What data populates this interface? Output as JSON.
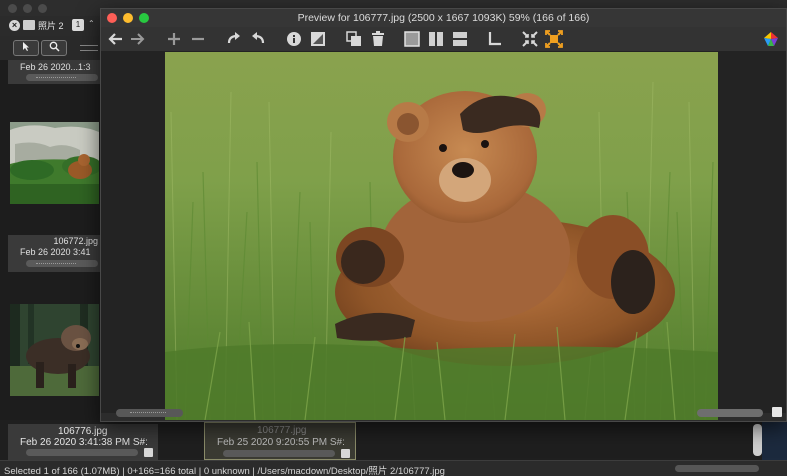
{
  "browser": {
    "tab": {
      "name": "照片 2",
      "count": "1",
      "close_symbol": "×",
      "caret": "⌃"
    },
    "toolbar": {
      "select_tool": "↖",
      "zoom_tool": "🔍"
    },
    "cells": [
      {
        "name": "",
        "date": "Feb 26 2020...1:3"
      },
      {
        "name": "106772.jpg",
        "date": "Feb 26 2020 3:41"
      },
      {
        "name": "",
        "date": ""
      }
    ],
    "bottom_cells": [
      {
        "name": "106776.jpg",
        "date": "Feb 26 2020 3:41:38 PM S#:"
      },
      {
        "name": "106777.jpg",
        "date": "Feb 25 2020 9:20:55 PM S#:"
      }
    ],
    "status": "Selected 1 of 166 (1.07MB) | 0+166=166 total | 0 unknown | /Users/macdown/Desktop/照片 2/106777.jpg"
  },
  "preview": {
    "title": "Preview for 106777.jpg (2500 x 1667 1093K) 59% (166 of 166)",
    "toolbar": [
      {
        "name": "back-arrow-icon"
      },
      {
        "name": "forward-arrow-icon"
      },
      {
        "name": "zoom-in-icon"
      },
      {
        "name": "zoom-out-icon"
      },
      {
        "name": "rotate-left-icon"
      },
      {
        "name": "rotate-right-icon"
      },
      {
        "name": "info-icon"
      },
      {
        "name": "image-adjust-icon"
      },
      {
        "name": "copy-icon"
      },
      {
        "name": "trash-icon"
      },
      {
        "name": "single-view-icon"
      },
      {
        "name": "split-vertical-icon"
      },
      {
        "name": "split-horizontal-icon"
      },
      {
        "name": "crop-icon"
      },
      {
        "name": "shrink-icon"
      },
      {
        "name": "expand-icon"
      },
      {
        "name": "app-logo-icon"
      }
    ]
  },
  "colors": {
    "accent_orange": "#f0a020",
    "close_red": "#fe5f57",
    "minimize_yellow": "#febc2e",
    "zoom_green": "#28c840"
  }
}
